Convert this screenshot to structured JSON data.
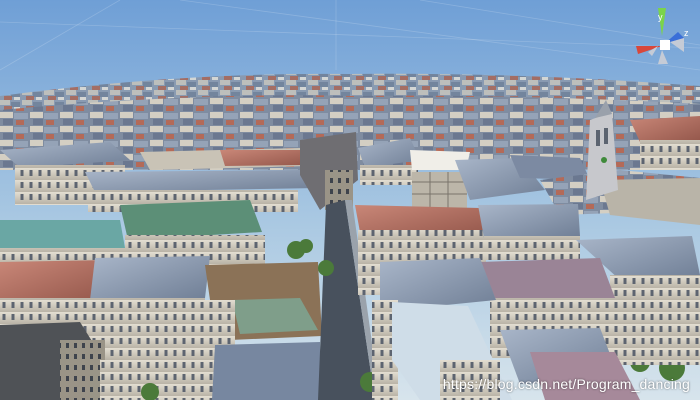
{
  "view": {
    "title": "",
    "sky_top_color": "#7aa4d6",
    "sky_horizon_color": "#d9e6ef",
    "roof_slate_color": "#8e9db3",
    "roof_red_color": "#b8695c",
    "facade_color": "#d8d3c6",
    "street_color": "#4b5563"
  },
  "gizmo": {
    "name": "scene-orientation-gizmo",
    "axes": [
      {
        "label": "y",
        "color": "#7bd44a",
        "icon": "y-axis-cone-icon"
      },
      {
        "label": "z",
        "color": "#3a6fd8",
        "icon": "z-axis-cone-icon"
      },
      {
        "label": "",
        "color": "#d8473a",
        "icon": "x-axis-cone-icon"
      }
    ]
  },
  "watermark": {
    "text": "https://blog.csdn.net/Program_dancing"
  }
}
